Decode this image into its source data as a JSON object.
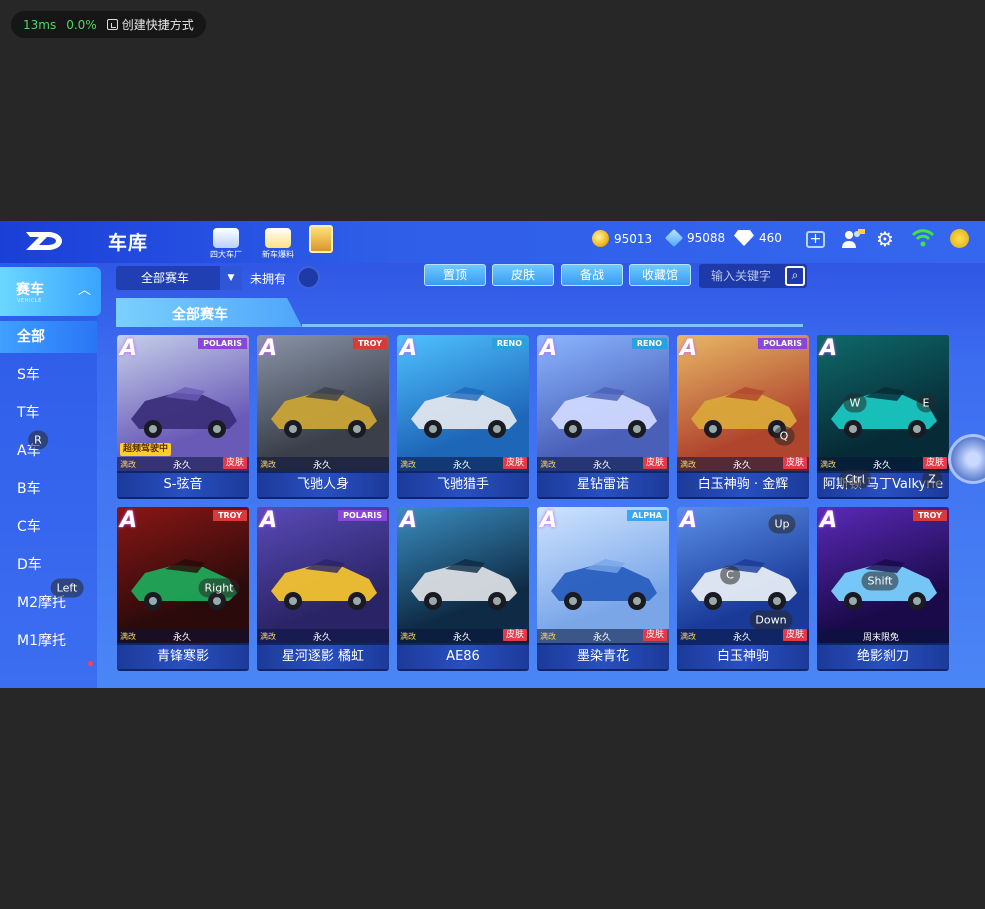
{
  "stats": {
    "latency": "13ms",
    "loss": "0.0%",
    "shortcut_label": "创建快捷方式"
  },
  "header": {
    "title": "车库",
    "icons": [
      {
        "label": "四大车厂",
        "icon": "factory-icon"
      },
      {
        "label": "新车爆料",
        "icon": "new-car-icon"
      }
    ],
    "coins": "95013",
    "vouchers": "95088",
    "diamonds": "460"
  },
  "sidebar": {
    "category": {
      "label": "赛车",
      "sub": "VEHICLE"
    },
    "items": [
      {
        "label": "全部",
        "active": true
      },
      {
        "label": "S车"
      },
      {
        "label": "T车"
      },
      {
        "label": "A车"
      },
      {
        "label": "B车"
      },
      {
        "label": "C车"
      },
      {
        "label": "D车"
      },
      {
        "label": "M2摩托"
      },
      {
        "label": "M1摩托"
      }
    ]
  },
  "filters": {
    "dropdown_value": "全部赛车",
    "unowned_label": "未拥有",
    "buttons": [
      "置顶",
      "皮肤",
      "备战",
      "收藏馆"
    ],
    "search_placeholder": "输入关键字"
  },
  "section_title": "全部赛车",
  "cards": [
    {
      "name": "S-弦音",
      "grade": "A",
      "brand": "POLARIS",
      "brand_color": "#8a46d8",
      "mod": "满改",
      "term": "永久",
      "skin": "皮肤",
      "badge": "超频驾驶中",
      "palette": [
        "#c6d0ea",
        "#6a5ab8",
        "#3b2e7a"
      ]
    },
    {
      "name": "飞驰人身",
      "grade": "A",
      "brand": "TROY",
      "brand_color": "#d83a3a",
      "mod": "满改",
      "term": "永久",
      "skin": "",
      "palette": [
        "#8a95a8",
        "#3a3f4a",
        "#c9a436"
      ]
    },
    {
      "name": "飞驰猎手",
      "grade": "A",
      "brand": "RENO",
      "brand_color": "#2ba0e0",
      "mod": "满改",
      "term": "永久",
      "skin": "皮肤",
      "palette": [
        "#4fc2ff",
        "#1e66b8",
        "#dfe6ee"
      ]
    },
    {
      "name": "星钻雷诺",
      "grade": "A",
      "brand": "RENO",
      "brand_color": "#2ba0e0",
      "mod": "满改",
      "term": "永久",
      "skin": "皮肤",
      "palette": [
        "#8cb7ff",
        "#4a5fb8",
        "#cfd8ff"
      ]
    },
    {
      "name": "白玉神驹 · 金辉",
      "grade": "A",
      "brand": "POLARIS",
      "brand_color": "#8a46d8",
      "mod": "满改",
      "term": "永久",
      "skin": "皮肤",
      "palette": [
        "#e8b866",
        "#b0452e",
        "#d9a83a"
      ]
    },
    {
      "name": "阿斯顿·马丁Valkyrie",
      "grade": "A",
      "brand": "",
      "brand_color": "",
      "mod": "满改",
      "term": "永久",
      "skin": "皮肤",
      "palette": [
        "#0f6a6a",
        "#062a36",
        "#19c6c0"
      ]
    },
    {
      "name": "青锋寒影",
      "grade": "A",
      "brand": "TROY",
      "brand_color": "#d83a3a",
      "mod": "满改",
      "term": "永久",
      "skin": "",
      "palette": [
        "#8a1616",
        "#2a0a0a",
        "#1fa85a"
      ]
    },
    {
      "name": "星河逐影 橘虹",
      "grade": "A",
      "brand": "POLARIS",
      "brand_color": "#8a46d8",
      "mod": "满改",
      "term": "永久",
      "skin": "",
      "palette": [
        "#5a4ab8",
        "#2a2466",
        "#f2c230"
      ]
    },
    {
      "name": "AE86",
      "grade": "A",
      "brand": "",
      "brand_color": "",
      "mod": "满改",
      "term": "永久",
      "skin": "皮肤",
      "palette": [
        "#3a8ec0",
        "#0e2a44",
        "#d9dde2"
      ]
    },
    {
      "name": "墨染青花",
      "grade": "A",
      "brand": "ALPHA",
      "brand_color": "#3aa6f0",
      "mod": "满改",
      "term": "永久",
      "skin": "皮肤",
      "palette": [
        "#cfe4ff",
        "#7aa6e8",
        "#2a5fc0"
      ]
    },
    {
      "name": "白玉神驹",
      "grade": "A",
      "brand": "",
      "brand_color": "",
      "mod": "满改",
      "term": "永久",
      "skin": "皮肤",
      "palette": [
        "#5a8fe8",
        "#1a3a98",
        "#e6ecf6"
      ]
    },
    {
      "name": "绝影刹刀",
      "grade": "A",
      "brand": "TROY",
      "brand_color": "#d83a3a",
      "mod": "",
      "term": "周末限免",
      "skin": "",
      "palette": [
        "#5a2ab8",
        "#1a0a4a",
        "#7ad0ff"
      ]
    }
  ],
  "key_hints": [
    {
      "key": "R"
    },
    {
      "key": "Left"
    },
    {
      "key": "Right"
    },
    {
      "key": "W"
    },
    {
      "key": "E"
    },
    {
      "key": "Q"
    },
    {
      "key": "Ctrl"
    },
    {
      "key": "Z"
    },
    {
      "key": "Up"
    },
    {
      "key": "C"
    },
    {
      "key": "Down"
    },
    {
      "key": "Shift"
    }
  ]
}
